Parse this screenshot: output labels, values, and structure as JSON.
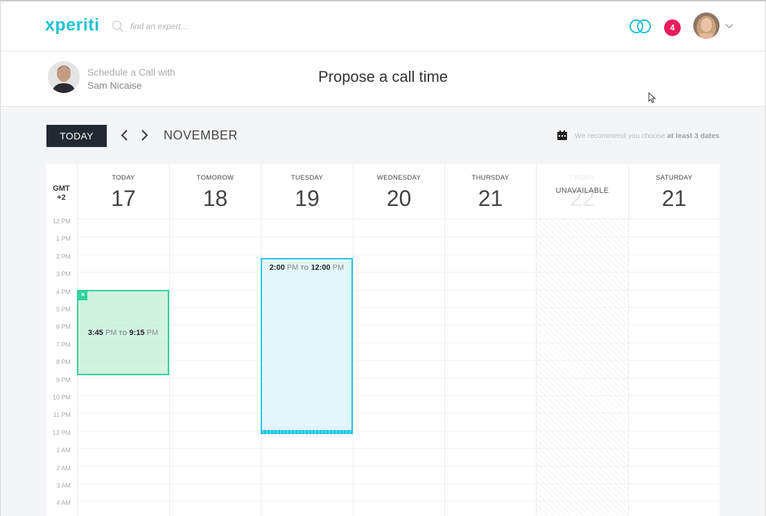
{
  "nav": {
    "logo": "xperiti",
    "search_placeholder": "find an expert...",
    "notification_count": "4",
    "colors": {
      "brand": "#1fc3d4",
      "badge": "#ec1c5b"
    }
  },
  "header": {
    "schedule_label": "Schedule a Call with",
    "expert_name": "Sam Nicaise",
    "page_title": "Propose a call time"
  },
  "toolbar": {
    "today_label": "TODAY",
    "month": "NOVEMBER",
    "recommend_prefix": "We recommend you choose ",
    "recommend_bold": "at least 3 dates"
  },
  "calendar": {
    "timezone_line1": "GMT",
    "timezone_line2": "+2",
    "days": [
      {
        "name": "TODAY",
        "num": "17"
      },
      {
        "name": "TOMOROW",
        "num": "18"
      },
      {
        "name": "TUESDAY",
        "num": "19"
      },
      {
        "name": "WEDNESDAY",
        "num": "20"
      },
      {
        "name": "THURSDAY",
        "num": "21"
      },
      {
        "name": "FRIDAY",
        "num": "22",
        "unavailable_label": "UNAVAILABLE"
      },
      {
        "name": "SATURDAY",
        "num": "21"
      }
    ],
    "hours": [
      "12 PM",
      "1 PM",
      "2 PM",
      "3 PM",
      "4 PM",
      "5 PM",
      "6 PM",
      "7 PM",
      "8 PM",
      "9 PM",
      "10 PM",
      "11 PM",
      "12 PM",
      "1 AM",
      "2 AM",
      "3 AM",
      "4 AM"
    ],
    "slots": [
      {
        "start": "3:45",
        "start_suffix": " PM",
        "to": "TO",
        "end": "9:15",
        "end_suffix": " PM",
        "close_label": "×"
      },
      {
        "start": "2:00",
        "start_suffix": " PM",
        "to": "TO",
        "end": "12:00",
        "end_suffix": " PM"
      }
    ]
  }
}
